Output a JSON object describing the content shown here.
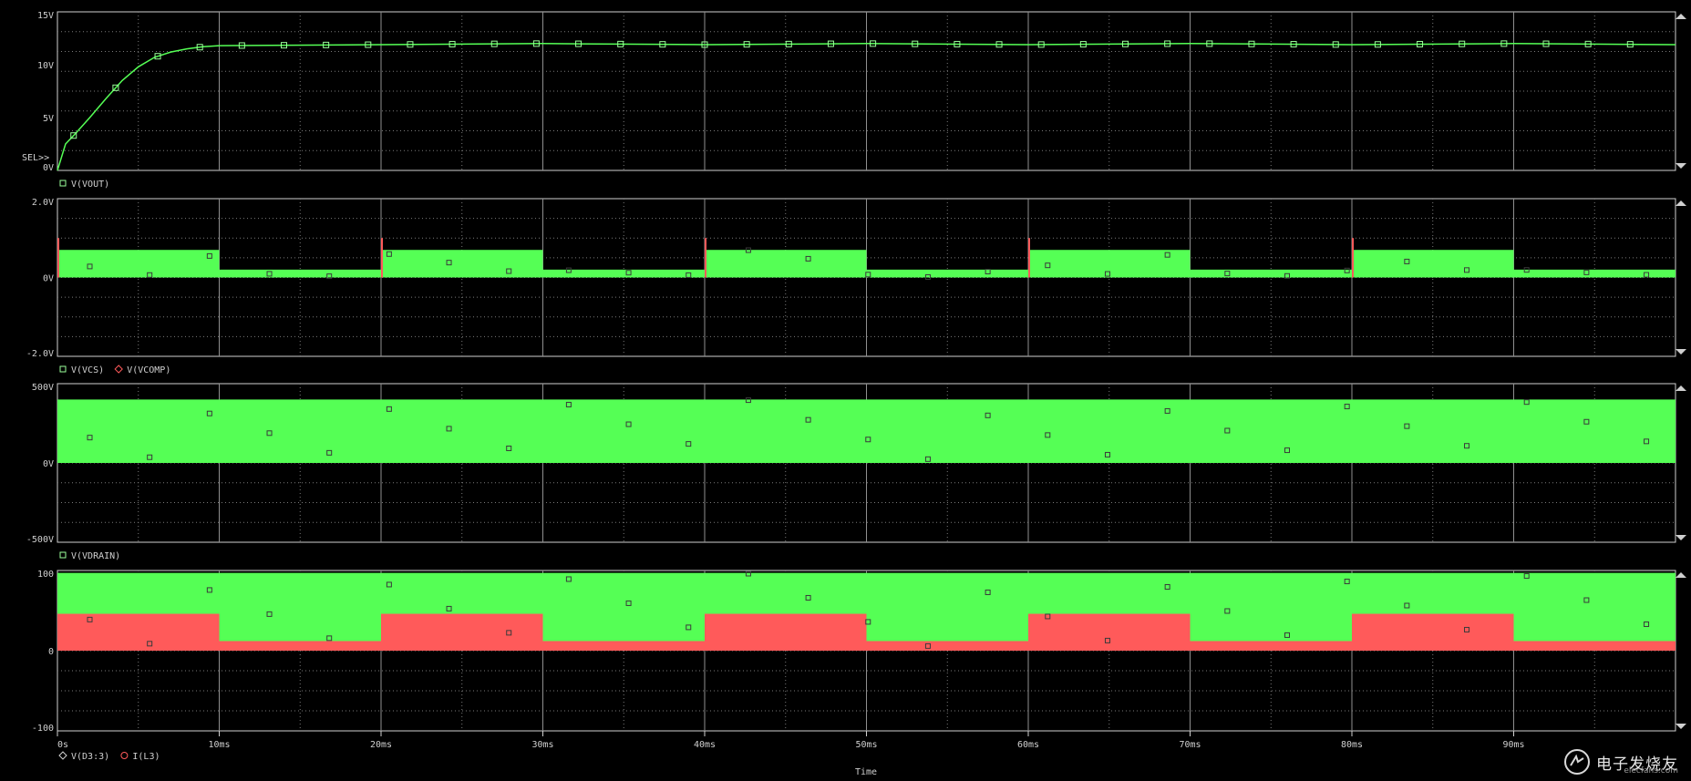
{
  "colors": {
    "background": "#000000",
    "frame": "#cfcfcf",
    "grid": "#7a7a7a",
    "trace_green": "#55ff55",
    "trace_red": "#ff5a5a",
    "marker_green": "#9aff9a"
  },
  "plot": {
    "time_label": "Time",
    "x_ticks": [
      "0s",
      "10ms",
      "20ms",
      "30ms",
      "40ms",
      "50ms",
      "60ms",
      "70ms",
      "80ms",
      "90ms"
    ],
    "sel_marker": "SEL>>"
  },
  "chart_data": [
    {
      "type": "line",
      "xlabel": "Time",
      "ylabel": "",
      "x_unit": "ms",
      "xlim": [
        0,
        100
      ],
      "ylim": [
        0,
        15
      ],
      "y_ticks": [
        "15V",
        "10V",
        "5V",
        "0V"
      ],
      "legend": [
        {
          "marker": "square",
          "label": "V(VOUT)"
        }
      ],
      "series": [
        {
          "name": "V(VOUT)",
          "x": [
            0,
            0.5,
            1,
            2,
            3,
            4,
            5,
            6,
            7,
            8,
            9,
            10,
            20,
            30,
            40,
            50,
            60,
            70,
            80,
            90,
            100
          ],
          "y": [
            0,
            2.5,
            3.3,
            5.0,
            6.8,
            8.5,
            9.8,
            10.7,
            11.2,
            11.5,
            11.7,
            11.8,
            11.9,
            12.0,
            11.9,
            12.0,
            11.9,
            12.0,
            11.9,
            12.0,
            11.9
          ]
        }
      ]
    },
    {
      "type": "area",
      "xlabel": "Time",
      "x_unit": "ms",
      "xlim": [
        0,
        100
      ],
      "ylim": [
        -2,
        2
      ],
      "y_ticks": [
        "2.0V",
        "0V",
        "-2.0V"
      ],
      "legend": [
        {
          "marker": "square",
          "label": "V(VCS)"
        },
        {
          "marker": "diamond",
          "label": "V(VCOMP)"
        }
      ],
      "series": [
        {
          "name": "V(VCS)",
          "segments": [
            {
              "x_start": 0,
              "x_end": 10,
              "low": 0,
              "high": 0.7
            },
            {
              "x_start": 10,
              "x_end": 20,
              "low": 0,
              "high": 0.2
            },
            {
              "x_start": 20,
              "x_end": 30,
              "low": 0,
              "high": 0.7
            },
            {
              "x_start": 30,
              "x_end": 40,
              "low": 0,
              "high": 0.2
            },
            {
              "x_start": 40,
              "x_end": 50,
              "low": 0,
              "high": 0.7
            },
            {
              "x_start": 50,
              "x_end": 60,
              "low": 0,
              "high": 0.2
            },
            {
              "x_start": 60,
              "x_end": 70,
              "low": 0,
              "high": 0.7
            },
            {
              "x_start": 70,
              "x_end": 80,
              "low": 0,
              "high": 0.2
            },
            {
              "x_start": 80,
              "x_end": 90,
              "low": 0,
              "high": 0.7
            },
            {
              "x_start": 90,
              "x_end": 100,
              "low": 0,
              "high": 0.2
            }
          ]
        }
      ]
    },
    {
      "type": "area",
      "xlabel": "Time",
      "x_unit": "ms",
      "xlim": [
        0,
        100
      ],
      "ylim": [
        -500,
        500
      ],
      "y_ticks": [
        "500V",
        "0V",
        "-500V"
      ],
      "legend": [
        {
          "marker": "square",
          "label": "V(VDRAIN)"
        }
      ],
      "series": [
        {
          "name": "V(VDRAIN)",
          "segments": [
            {
              "x_start": 0,
              "x_end": 100,
              "low": 0,
              "high": 400
            }
          ]
        }
      ]
    },
    {
      "type": "area",
      "xlabel": "Time",
      "x_unit": "ms",
      "xlim": [
        0,
        100
      ],
      "ylim": [
        -100,
        100
      ],
      "y_ticks": [
        "100",
        "0",
        "-100"
      ],
      "legend": [
        {
          "marker": "diamond",
          "label": "V(D3:3)"
        },
        {
          "marker": "circle",
          "label": "I(L3)"
        }
      ],
      "series": [
        {
          "name": "V(D3:3)",
          "segments": [
            {
              "x_start": 0,
              "x_end": 100,
              "low": 0,
              "high": 97
            }
          ]
        },
        {
          "name": "I(L3)",
          "segments": [
            {
              "x_start": 0,
              "x_end": 10,
              "low": 0,
              "high": 46
            },
            {
              "x_start": 10,
              "x_end": 20,
              "low": 0,
              "high": 12
            },
            {
              "x_start": 20,
              "x_end": 30,
              "low": 0,
              "high": 46
            },
            {
              "x_start": 30,
              "x_end": 40,
              "low": 0,
              "high": 12
            },
            {
              "x_start": 40,
              "x_end": 50,
              "low": 0,
              "high": 46
            },
            {
              "x_start": 50,
              "x_end": 60,
              "low": 0,
              "high": 12
            },
            {
              "x_start": 60,
              "x_end": 70,
              "low": 0,
              "high": 46
            },
            {
              "x_start": 70,
              "x_end": 80,
              "low": 0,
              "high": 12
            },
            {
              "x_start": 80,
              "x_end": 90,
              "low": 0,
              "high": 46
            },
            {
              "x_start": 90,
              "x_end": 100,
              "low": 0,
              "high": 12
            }
          ]
        }
      ]
    }
  ],
  "watermark": {
    "text": "电子发烧友",
    "sub": "elecfans.com"
  }
}
